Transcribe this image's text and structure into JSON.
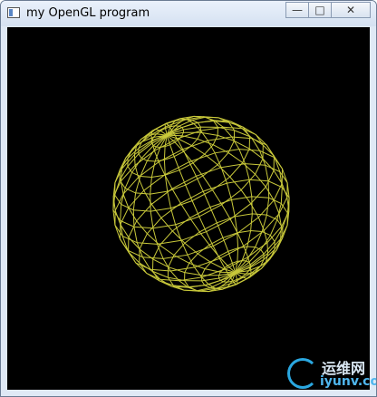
{
  "window": {
    "title": "my  OpenGL program",
    "controls": {
      "minimize": "—",
      "maximize": "□",
      "close": "✕"
    }
  },
  "scene": {
    "background": "#000000",
    "wire_color": "#c8c83a",
    "object": "wireframe-sphere"
  },
  "watermark": {
    "brand_cn": "运维网",
    "domain": "iyunv.com"
  }
}
